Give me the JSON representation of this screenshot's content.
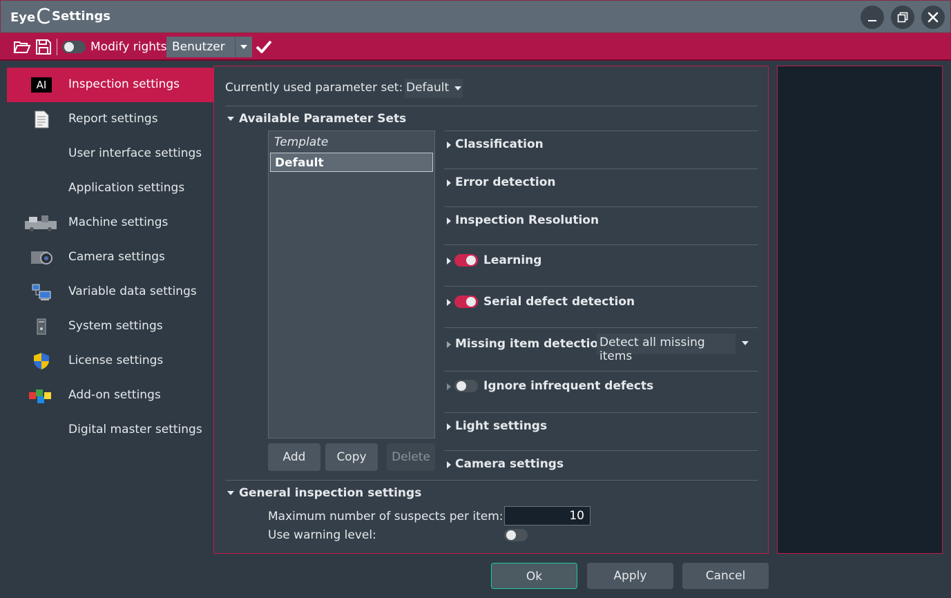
{
  "window": {
    "logo_text": "Eye",
    "logo_c": "C",
    "title": "Settings"
  },
  "toolbar": {
    "modify_rights_label": "Modify rights",
    "modify_rights_on": false,
    "user_value": "Benutzer"
  },
  "sidebar": {
    "items": [
      {
        "label": "Inspection settings",
        "icon": "ai-icon",
        "active": true
      },
      {
        "label": "Report settings",
        "icon": "document-icon"
      },
      {
        "label": "User interface settings",
        "icon": ""
      },
      {
        "label": "Application settings",
        "icon": ""
      },
      {
        "label": "Machine settings",
        "icon": "machine-icon"
      },
      {
        "label": "Camera settings",
        "icon": "camera-icon"
      },
      {
        "label": "Variable data settings",
        "icon": "network-computer-icon"
      },
      {
        "label": "System settings",
        "icon": "tower-pc-icon"
      },
      {
        "label": "License settings",
        "icon": "shield-icon"
      },
      {
        "label": "Add-on settings",
        "icon": "puzzle-icon"
      },
      {
        "label": "Digital master settings",
        "icon": ""
      }
    ],
    "ai_badge": "AI"
  },
  "main": {
    "current_param_label": "Currently used parameter set:",
    "current_param_value": "Default",
    "available_sets_title": "Available Parameter Sets",
    "param_list": [
      {
        "label": "Template",
        "italic": true
      },
      {
        "label": "Default",
        "selected": true
      }
    ],
    "buttons": {
      "add": "Add",
      "copy": "Copy",
      "delete": "Delete"
    },
    "sections": [
      {
        "label": "Classification"
      },
      {
        "label": "Error detection"
      },
      {
        "label": "Inspection Resolution"
      },
      {
        "label": "Learning",
        "toggle": true,
        "on": true
      },
      {
        "label": "Serial defect detection",
        "toggle": true,
        "on": true
      },
      {
        "label": "Missing item detection",
        "select": "Detect all missing items"
      },
      {
        "label": "Ignore infrequent defects",
        "toggle": true,
        "on": false
      },
      {
        "label": "Light settings"
      },
      {
        "label": "Camera settings"
      }
    ],
    "general_title": "General inspection settings",
    "max_suspects_label": "Maximum number of suspects per item:",
    "max_suspects_value": "10",
    "warning_level_label": "Use warning level:",
    "warning_level_on": false
  },
  "footer": {
    "ok": "Ok",
    "apply": "Apply",
    "cancel": "Cancel"
  },
  "colors": {
    "accent": "#c41a4c",
    "toolbar": "#b0154a",
    "background": "#2f3a44",
    "ok_border": "#1ec9a0"
  }
}
